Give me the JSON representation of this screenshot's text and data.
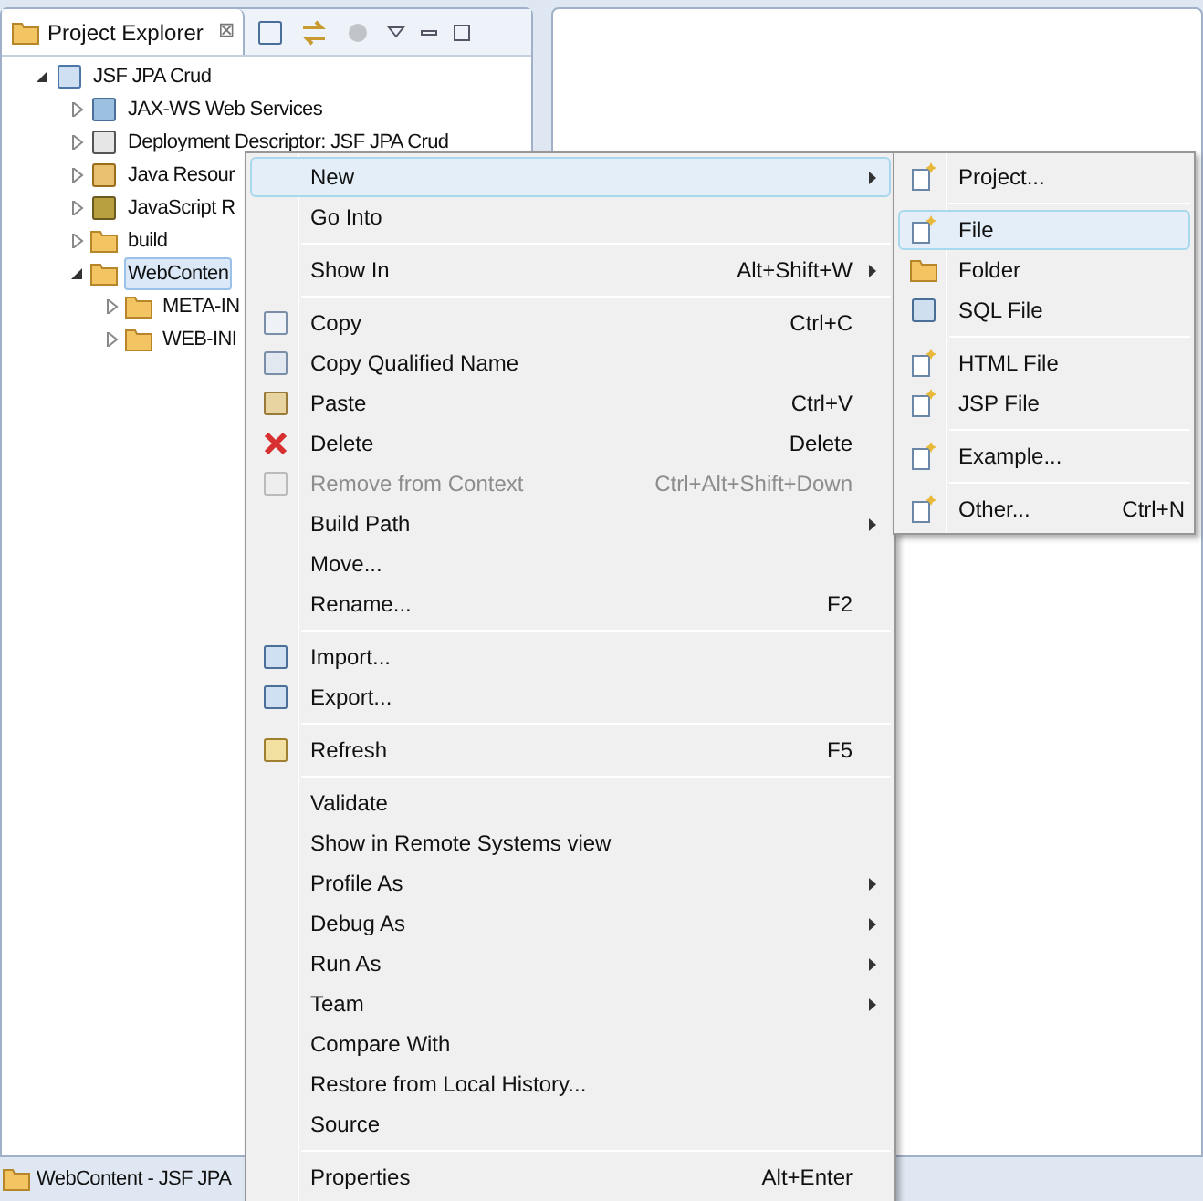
{
  "panel": {
    "tab": {
      "label": "Project Explorer",
      "close": "⊠"
    }
  },
  "tree": [
    {
      "label": "JSF JPA Crud",
      "expanded": true,
      "selected": false,
      "children": [
        {
          "label": "JAX-WS Web Services",
          "expanded": false,
          "selected": false
        },
        {
          "label": "Deployment Descriptor: JSF JPA Crud",
          "expanded": false,
          "selected": false
        },
        {
          "label": "Java Resour",
          "expanded": false,
          "selected": false
        },
        {
          "label": "JavaScript R",
          "expanded": false,
          "selected": false
        },
        {
          "label": "build",
          "expanded": false,
          "selected": false
        },
        {
          "label": "WebConten",
          "expanded": true,
          "selected": true,
          "children": [
            {
              "label": "META-IN",
              "expanded": false,
              "selected": false
            },
            {
              "label": "WEB-INI",
              "expanded": false,
              "selected": false
            }
          ]
        }
      ]
    }
  ],
  "status_bar": "WebContent - JSF JPA",
  "context_menu": [
    [
      {
        "label": "New",
        "submenu": true,
        "disabled": false,
        "selected": true
      },
      {
        "label": "Go Into",
        "submenu": false,
        "disabled": false,
        "selected": false
      }
    ],
    [
      {
        "label": "Show In",
        "shortcut": "Alt+Shift+W",
        "submenu": true,
        "disabled": false,
        "selected": false
      }
    ],
    [
      {
        "label": "Copy",
        "shortcut": "Ctrl+C",
        "submenu": false,
        "disabled": false,
        "selected": false
      },
      {
        "label": "Copy Qualified Name",
        "submenu": false,
        "disabled": false,
        "selected": false
      },
      {
        "label": "Paste",
        "shortcut": "Ctrl+V",
        "submenu": false,
        "disabled": false,
        "selected": false
      },
      {
        "label": "Delete",
        "shortcut": "Delete",
        "submenu": false,
        "disabled": false,
        "selected": false
      },
      {
        "label": "Remove from Context",
        "shortcut": "Ctrl+Alt+Shift+Down",
        "submenu": false,
        "disabled": true,
        "selected": false
      },
      {
        "label": "Build Path",
        "submenu": true,
        "disabled": false,
        "selected": false
      },
      {
        "label": "Move...",
        "submenu": false,
        "disabled": false,
        "selected": false
      },
      {
        "label": "Rename...",
        "shortcut": "F2",
        "submenu": false,
        "disabled": false,
        "selected": false
      }
    ],
    [
      {
        "label": "Import...",
        "submenu": false,
        "disabled": false,
        "selected": false
      },
      {
        "label": "Export...",
        "submenu": false,
        "disabled": false,
        "selected": false
      }
    ],
    [
      {
        "label": "Refresh",
        "shortcut": "F5",
        "submenu": false,
        "disabled": false,
        "selected": false
      }
    ],
    [
      {
        "label": "Validate",
        "submenu": false,
        "disabled": false,
        "selected": false
      },
      {
        "label": "Show in Remote Systems view",
        "submenu": false,
        "disabled": false,
        "selected": false
      },
      {
        "label": "Profile As",
        "submenu": true,
        "disabled": false,
        "selected": false
      },
      {
        "label": "Debug As",
        "submenu": true,
        "disabled": false,
        "selected": false
      },
      {
        "label": "Run As",
        "submenu": true,
        "disabled": false,
        "selected": false
      },
      {
        "label": "Team",
        "submenu": true,
        "disabled": false,
        "selected": false
      },
      {
        "label": "Compare With",
        "submenu": false,
        "disabled": false,
        "selected": false
      },
      {
        "label": "Restore from Local History...",
        "submenu": false,
        "disabled": false,
        "selected": false
      },
      {
        "label": "Source",
        "submenu": false,
        "disabled": false,
        "selected": false
      }
    ],
    [
      {
        "label": "Properties",
        "shortcut": "Alt+Enter",
        "submenu": false,
        "disabled": false,
        "selected": false
      }
    ]
  ],
  "submenu": [
    [
      {
        "label": "Project...",
        "selected": false
      }
    ],
    [
      {
        "label": "File",
        "selected": true
      },
      {
        "label": "Folder",
        "selected": false
      },
      {
        "label": "SQL File",
        "selected": false
      }
    ],
    [
      {
        "label": "HTML File",
        "selected": false
      },
      {
        "label": "JSP File",
        "selected": false
      }
    ],
    [
      {
        "label": "Example...",
        "selected": false
      }
    ],
    [
      {
        "label": "Other...",
        "shortcut": "Ctrl+N",
        "selected": false
      }
    ]
  ]
}
